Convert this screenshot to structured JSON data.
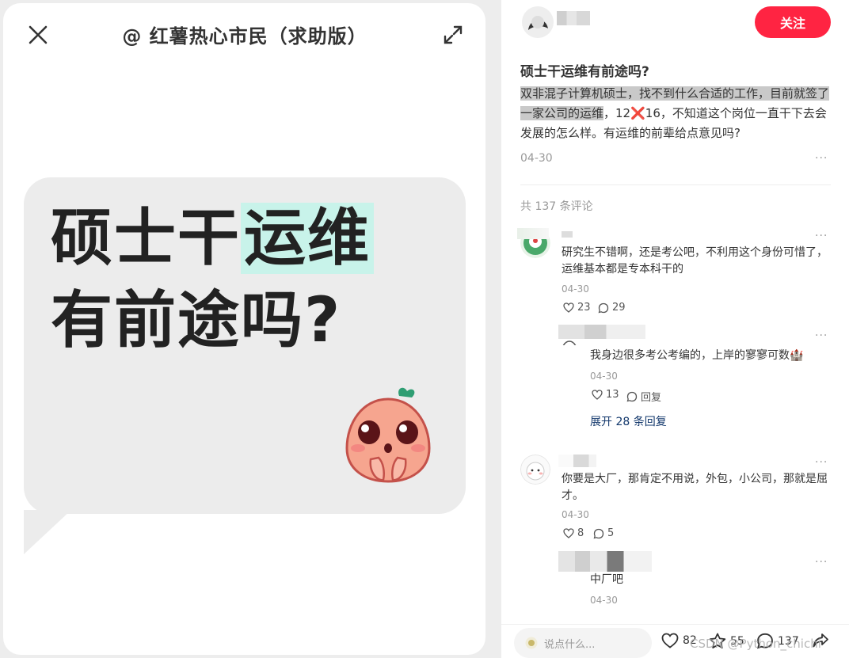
{
  "left": {
    "author_title": "@ 红薯热心市民（求助版）",
    "image_line1_a": "硕士干",
    "image_line1_b": "运维",
    "image_line2": "有前途吗?"
  },
  "post": {
    "follow_label": "关注",
    "title": "硕士干运维有前途吗?",
    "body_selected_1": "双非混子计算机硕士，找不到什么合适的工作，目前就签了一家公司的运维",
    "body_rest": "，12❌16，不知道这个岗位一直干下去会发展的怎么样。有运维的前辈给点意见吗?",
    "date": "04-30",
    "more": "···",
    "comment_count": "共 137 条评论"
  },
  "comments": [
    {
      "text": "研究生不错啊，还是考公吧，不利用这个身份可惜了，运维基本都是专本科干的",
      "date": "04-30",
      "likes": "23",
      "replies": "29",
      "reply": {
        "text": "我身边很多考公考编的，上岸的寥寥可数🏰",
        "date": "04-30",
        "likes": "13",
        "reply_label": "回复"
      },
      "expand_label": "展开 28 条回复"
    },
    {
      "text": "你要是大厂，那肯定不用说，外包，小公司，那就是屈才。",
      "date": "04-30",
      "likes": "8",
      "replies": "5",
      "reply": {
        "text": "中厂吧",
        "date": "04-30"
      }
    }
  ],
  "bottom_bar": {
    "input_placeholder": "说点什么...",
    "likes": "82",
    "stars": "55",
    "comments": "137"
  },
  "watermark": "CSDN @Python_chichi"
}
